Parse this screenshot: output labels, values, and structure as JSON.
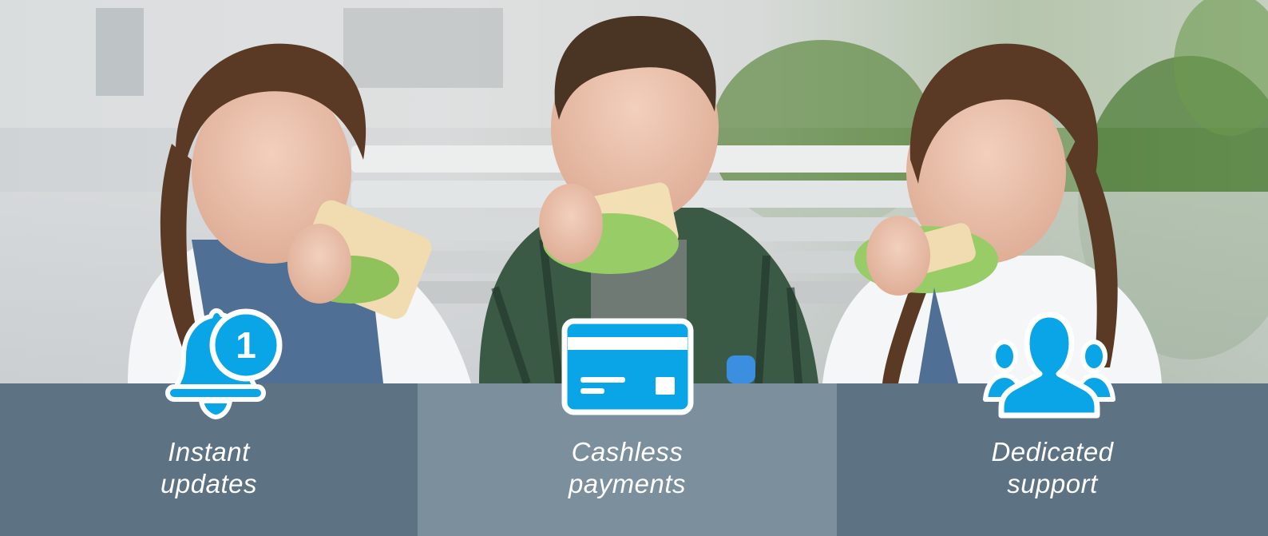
{
  "features": [
    {
      "icon": "bell-notification-icon",
      "badge": "1",
      "line1": "Instant",
      "line2": "updates",
      "bg": "#5d7282"
    },
    {
      "icon": "credit-card-icon",
      "line1": "Cashless",
      "line2": "payments",
      "bg": "#7c8f9c"
    },
    {
      "icon": "people-group-icon",
      "line1": "Dedicated",
      "line2": "support",
      "bg": "#5d7282"
    }
  ],
  "colors": {
    "icon_blue": "#0aa5e6",
    "icon_outline": "#ffffff"
  }
}
